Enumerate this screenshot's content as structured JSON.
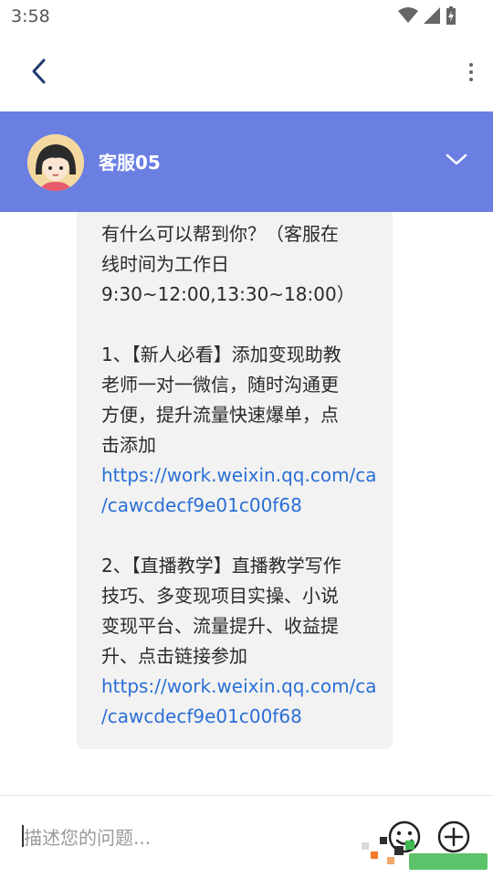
{
  "status_bar": {
    "time": "3:58"
  },
  "top_nav": {
    "back_icon": "chevron-left-icon",
    "more_icon": "vertical-ellipsis-icon"
  },
  "chat_header": {
    "agent_name": "客服05",
    "bg_color": "#6B7FE3",
    "collapse_icon": "chevron-down-icon"
  },
  "message": {
    "intro_lines": [
      "有什么可以帮到你？（客服在",
      "线时间为工作日",
      "9:30~12:00,13:30~18:00）"
    ],
    "item1_lines": [
      "1、【新人必看】添加变现助教",
      "老师一对一微信，随时沟通更",
      "方便，提升流量快速爆单，点",
      "击添加"
    ],
    "item1_link_lines": [
      "https://work.weixin.qq.com/ca",
      "/cawcdecf9e01c00f68"
    ],
    "item2_lines": [
      "2、【直播教学】直播教学写作",
      "技巧、多变现项目实操、小说",
      "变现平台、流量提升、收益提",
      "升、点击链接参加"
    ],
    "item2_link_lines": [
      "https://work.weixin.qq.com/ca",
      "/cawcdecf9e01c00f68"
    ],
    "link_color": "#2A6FD6"
  },
  "input_bar": {
    "placeholder": "描述您的问题...",
    "emoji_icon": "smiley-icon",
    "plus_icon": "plus-circle-icon"
  }
}
